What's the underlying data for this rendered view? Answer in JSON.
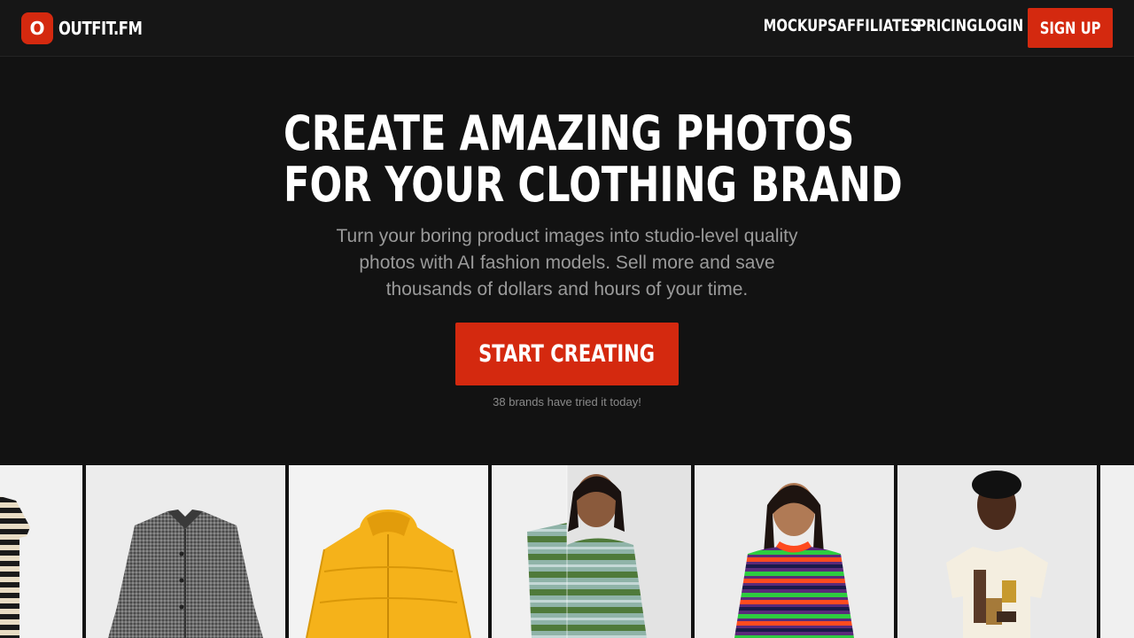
{
  "brand": {
    "mark": "O",
    "name": "OUTFIT.FM",
    "accent_color": "#d4290f"
  },
  "nav": {
    "links": [
      "MOCKUPS",
      "AFFILIATES",
      "PRICING",
      "LOGIN"
    ],
    "signup_label": "SIGN UP"
  },
  "hero": {
    "title_line_1": "CREATE AMAZING PHOTOS",
    "title_line_2": "FOR YOUR CLOTHING BRAND",
    "subtitle": "Turn your boring product images into studio-level quality photos with AI fashion models. Sell more and save thousands of dollars and hours of your time.",
    "cta_label": "START CREATING",
    "social_proof": "38 brands have tried it today!"
  },
  "gallery": {
    "tiles": [
      {
        "kind": "product",
        "item": "striped dress"
      },
      {
        "kind": "product",
        "item": "gray tweed jacket"
      },
      {
        "kind": "product",
        "item": "yellow puffer jacket"
      },
      {
        "kind": "before-after",
        "item": "green knit sweater on model"
      },
      {
        "kind": "model",
        "item": "striped sweater on model"
      },
      {
        "kind": "model",
        "item": "graphic t-shirt on model"
      }
    ]
  }
}
